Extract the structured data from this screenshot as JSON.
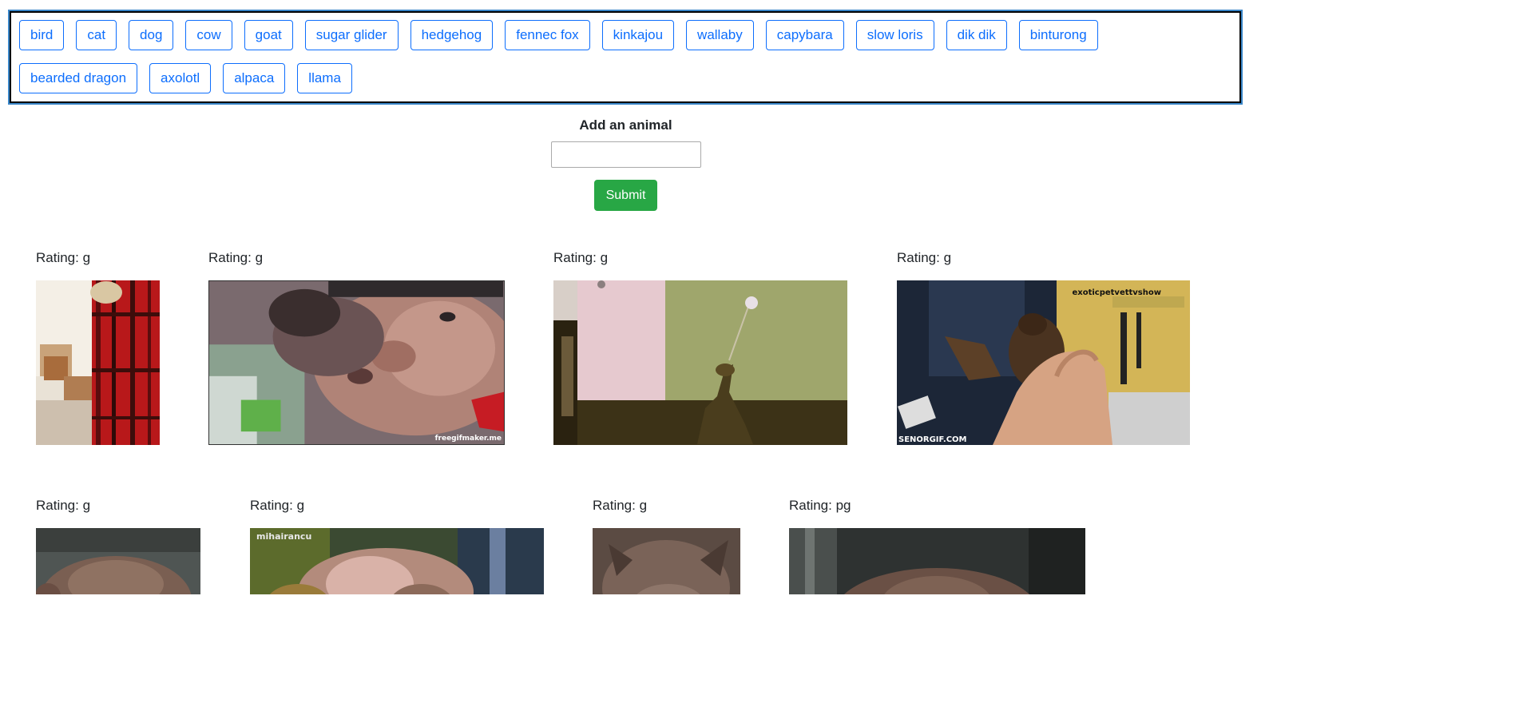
{
  "animal_buttons": [
    "bird",
    "cat",
    "dog",
    "cow",
    "goat",
    "sugar glider",
    "hedgehog",
    "fennec fox",
    "kinkajou",
    "wallaby",
    "capybara",
    "slow loris",
    "dik dik",
    "binturong",
    "bearded dragon",
    "axolotl",
    "alpaca",
    "llama"
  ],
  "form": {
    "label": "Add an animal",
    "input_value": "",
    "submit_label": "Submit"
  },
  "gifs": [
    {
      "rating": "Rating: g",
      "watermark": ""
    },
    {
      "rating": "Rating: g",
      "watermark": "freegifmaker.me"
    },
    {
      "rating": "Rating: g",
      "watermark": ""
    },
    {
      "rating": "Rating: g",
      "watermark": "SENORGIF.COM",
      "watermark2": "exoticpetvettvshow"
    },
    {
      "rating": "Rating: g",
      "watermark": ""
    },
    {
      "rating": "Rating: g",
      "watermark": "mihairancu"
    },
    {
      "rating": "Rating: g",
      "watermark": ""
    },
    {
      "rating": "Rating: pg",
      "watermark": ""
    }
  ],
  "colors": {
    "button_outline": "#0d6efd",
    "submit_bg": "#28a745",
    "container_border": "#000000"
  }
}
